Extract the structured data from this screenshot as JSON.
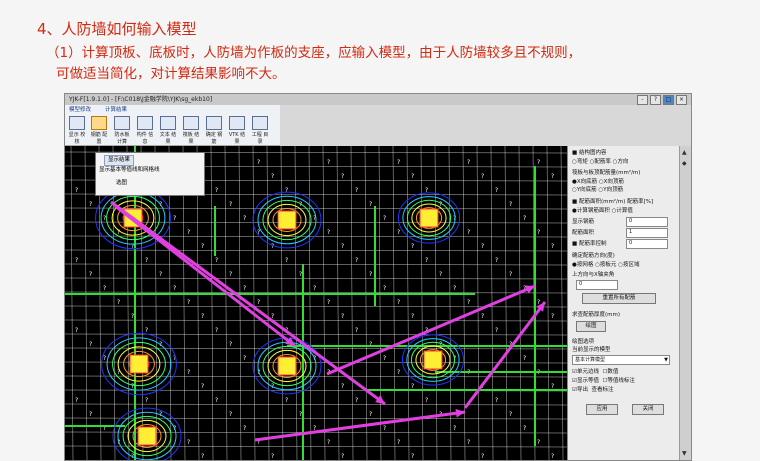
{
  "slide": {
    "heading": "4、人防墙如何输入模型",
    "para_line1": "（1）计算顶板、底板时，人防墙为作板的支座，应输入模型，由于人防墙较多且不规则，",
    "para_line2": "可做适当简化，对计算结果影响不大。"
  },
  "window": {
    "title": "YJK-F[1.9.1.0] - [F:\\C018\\J金融学院\\YJK\\sg_ekb10]",
    "controls": [
      "-",
      "?",
      "□",
      "×"
    ]
  },
  "ribbon": {
    "tabs": [
      "模型修改",
      "计算结果"
    ],
    "tools": [
      "显示\n校核",
      "钢筋\n配置",
      "防水板\n计算",
      "构件\n信息",
      "文本\n结果",
      "筏板\n结果",
      "确定\n钢筋",
      "VTK\n结果",
      "工程\n目录"
    ]
  },
  "popup": {
    "items": [
      "显示结果",
      "显示基本等值线和网格线",
      "选图"
    ]
  },
  "panel": {
    "sec1_title": "■ 结构图内容",
    "sec1_radios": [
      "弯矩",
      "配筋率",
      "方向"
    ],
    "sec2_title": "筏板与板顶配筋量(mm²/m)",
    "sec2_radios": [
      "X向底筋",
      "X向顶筋",
      "Y向底筋",
      "Y向顶筋"
    ],
    "sec3_title": "■ 配筋面积(mm²/m) 配筋率[%]",
    "sec3_radios": [
      "计算钢筋面积",
      "计算值"
    ],
    "field1_label": "显示钢筋",
    "field1_value": "0",
    "field2_label": "配筋面积",
    "field2_value": "1",
    "field3_label": "■ 配筋率控制",
    "field3_value": "0",
    "sec4_title": "确定配筋方向(度)",
    "sec4_radios": [
      "按网格",
      "按板元",
      "按区域"
    ],
    "sec4_sub": "上方向与X轴夹角",
    "sec4_value": "0",
    "btn_reset": "重置所有配筋",
    "sec5_title": "求查配筋厚度(mm)",
    "btn_plot": "绘图",
    "sec6_title": "绘图选项",
    "sec6_sub": "当前显示的模型",
    "select_value": "基本计算模型",
    "checks": [
      "单元边线",
      "数值",
      "显示等值",
      "等值线标注",
      "导出",
      "查看标注"
    ],
    "btn_apply": "应用",
    "btn_close": "关闭"
  },
  "plot": {
    "background": "#000000",
    "grid_color": "#ffffff",
    "wall_color": "#33dd33",
    "arrow_color": "#e040e0",
    "hatch_char": "?"
  }
}
